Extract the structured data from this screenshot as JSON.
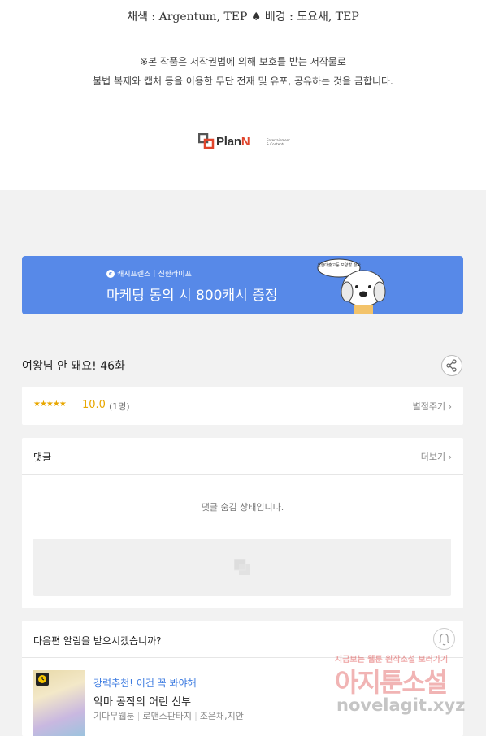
{
  "credits": "채색 : Argentum, TEP ♠ 배경 : 도요새, TEP",
  "notice": {
    "line1": "※본 작품은 저작권법에 의해 보호를 받는 저작물로",
    "line2": "불법 복제와 캡처 등을 이용한 무단 전재 및 유포, 공유하는 것을 금합니다."
  },
  "publisher_logo": {
    "name_main": "Plan",
    "name_accent": "N",
    "tagline": "Entertainment & Contents"
  },
  "banner": {
    "brand": "캐시프렌즈",
    "partner": "신한라이프",
    "headline": "마케팅 동의 시 800캐시 증정",
    "bubble": "신한대출고등 모양할 헐싸"
  },
  "episode": {
    "title": "여왕님 안 돼요! 46화"
  },
  "rating": {
    "stars": "★★★★★",
    "score": "10.0",
    "count": "(1명)",
    "rate_label": "별점주기"
  },
  "comments": {
    "title": "댓글",
    "more_label": "더보기",
    "hidden_message": "댓글 숨김 상태입니다."
  },
  "notify": {
    "question": "다음편 알림을 받으시겠습니까?"
  },
  "recommendation": {
    "promo": "강력추천! 이건 꼭 봐야해",
    "title": "악마 공작의 어린 신부",
    "badges": [
      "기다무웹툰",
      "로맨스판타지",
      "조은채,지안"
    ]
  },
  "watermark": {
    "small": "지금보는 웹툰 원작소설 보러가기",
    "big": "아지툰소설",
    "url": "novelagit.xyz"
  },
  "colors": {
    "banner": "#5789e8",
    "star": "#e8a700",
    "link_blue": "#3b7ae0",
    "logo_red": "#e0452c"
  }
}
